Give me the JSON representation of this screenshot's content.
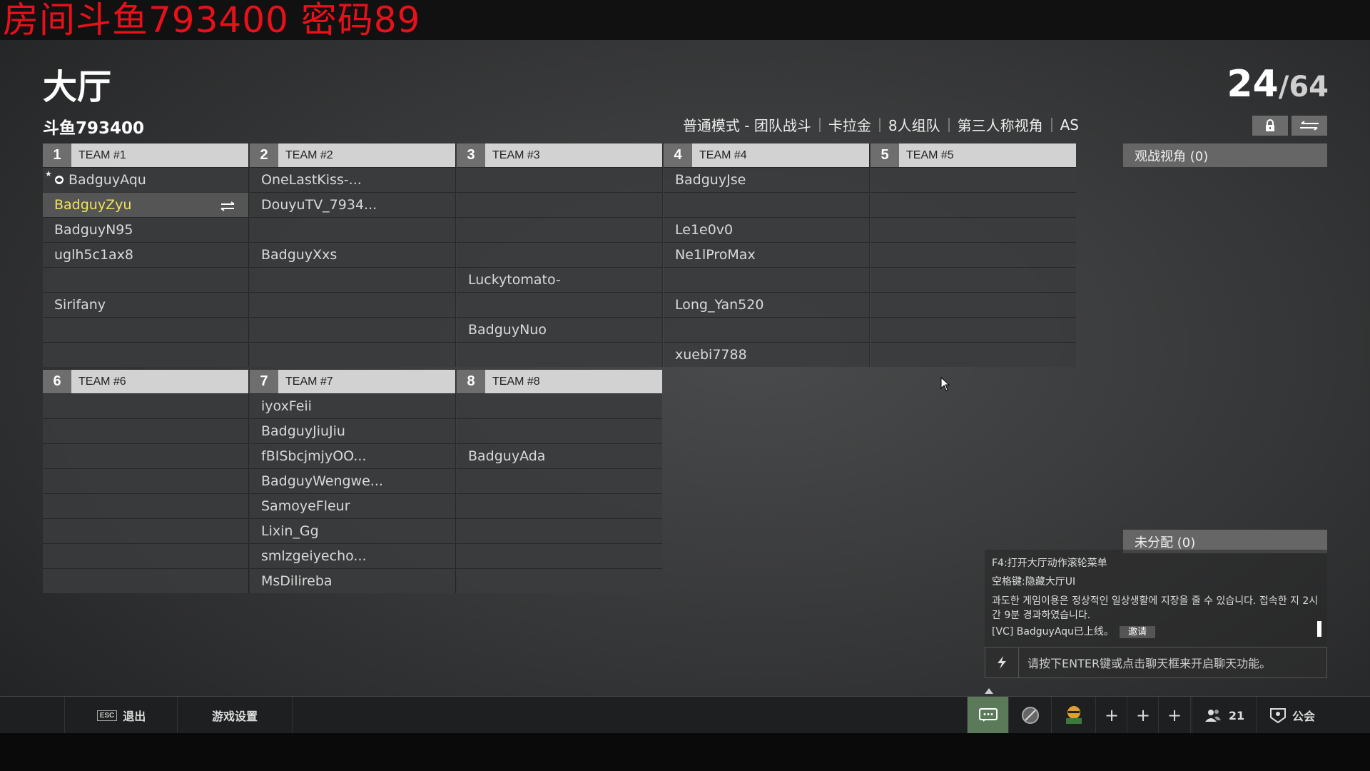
{
  "overlay_text": "房间斗鱼793400 密码89",
  "page_title": "大厅",
  "player_count": {
    "current": "24",
    "separator": "/",
    "max": "64"
  },
  "room_name": "斗鱼793400",
  "mode_info": [
    "普通模式 - 团队战斗",
    "卡拉金",
    "8人组队",
    "第三人称视角",
    "AS"
  ],
  "teams": [
    {
      "num": "1",
      "label": "TEAM #1",
      "slots": [
        "BadguyAqu",
        "BadguyZyu",
        "BadguyN95",
        "uglh5c1ax8",
        "",
        "Sirifany",
        "",
        ""
      ]
    },
    {
      "num": "2",
      "label": "TEAM #2",
      "slots": [
        "OneLastKiss-...",
        "DouyuTV_7934...",
        "",
        "BadguyXxs",
        "",
        "",
        "",
        ""
      ]
    },
    {
      "num": "3",
      "label": "TEAM #3",
      "slots": [
        "",
        "",
        "",
        "",
        "Luckytomato-",
        "",
        "BadguyNuo",
        ""
      ]
    },
    {
      "num": "4",
      "label": "TEAM #4",
      "slots": [
        "BadguyJse",
        "",
        "Le1e0v0",
        "Ne1lProMax",
        "",
        "Long_Yan520",
        "",
        "xuebi7788"
      ]
    },
    {
      "num": "5",
      "label": "TEAM #5",
      "slots": [
        "",
        "",
        "",
        "",
        "",
        "",
        "",
        ""
      ]
    },
    {
      "num": "6",
      "label": "TEAM #6",
      "slots": [
        "",
        "",
        "",
        "",
        "",
        "",
        "",
        ""
      ]
    },
    {
      "num": "7",
      "label": "TEAM #7",
      "slots": [
        "iyoxFeii",
        "BadguyJiuJiu",
        "fBISbcjmjyOO...",
        "BadguyWengwe...",
        "SamoyeFleur",
        "Lixin_Gg",
        "smlzgeiyecho...",
        "MsDilireba"
      ]
    },
    {
      "num": "8",
      "label": "TEAM #8",
      "slots": [
        "",
        "",
        "BadguyAda",
        "",
        "",
        "",
        "",
        ""
      ]
    }
  ],
  "observer_label": "观战视角 (0)",
  "unassigned_label": "未分配 (0)",
  "chat": {
    "line1": "F4:打开大厅动作滚轮菜单",
    "line2": "空格键:隐藏大厅UI",
    "line3": "과도한 게임이용은 정상적인 일상생활에 지장을 줄 수 있습니다. 접속한 지 2시간 9분 경과하였습니다.",
    "line4": "[VC] BadguyAqu已上线。",
    "invite": "邀请",
    "input_placeholder": "请按下ENTER键或点击聊天框来开启聊天功能。"
  },
  "bottom": {
    "esc_key": "ESC",
    "exit": "退出",
    "settings": "游戏设置",
    "friends_count": "21",
    "guild": "公会"
  },
  "colors": {
    "highlight_name": "#f1e45a",
    "overlay_red": "#e8101a",
    "chat_tab": "#5a7a5a"
  }
}
